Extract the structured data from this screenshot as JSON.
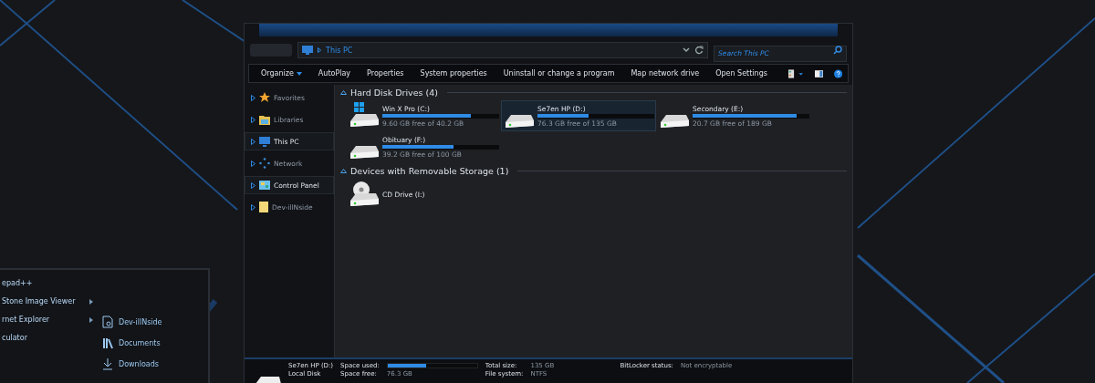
{
  "start_menu": {
    "programs": [
      {
        "label": "epad++",
        "submenu": false
      },
      {
        "label": "Stone Image Viewer",
        "submenu": true
      },
      {
        "label": "rnet Explorer",
        "submenu": true
      },
      {
        "label": "culator",
        "submenu": false
      }
    ],
    "places": [
      {
        "label": "Dev-illNside"
      },
      {
        "label": "Documents"
      },
      {
        "label": "Downloads"
      }
    ]
  },
  "explorer": {
    "address": "This PC",
    "search": {
      "placeholder": "Search This PC"
    },
    "toolbar": [
      {
        "label": "Organize",
        "dropdown": true
      },
      {
        "label": "AutoPlay",
        "dropdown": false
      },
      {
        "label": "Properties",
        "dropdown": false
      },
      {
        "label": "System properties",
        "dropdown": false
      },
      {
        "label": "Uninstall or change a program",
        "dropdown": false
      },
      {
        "label": "Map network drive",
        "dropdown": false
      },
      {
        "label": "Open Settings",
        "dropdown": false
      }
    ],
    "sidebar": [
      {
        "label": "Favorites",
        "selected": false
      },
      {
        "label": "Libraries",
        "selected": false
      },
      {
        "label": "This PC",
        "selected": true
      },
      {
        "label": "Network",
        "selected": false
      },
      {
        "label": "Control Panel",
        "selected": true
      },
      {
        "label": "Dev-illNside",
        "selected": false
      }
    ],
    "groups": [
      {
        "title": "Hard Disk Drives (4)",
        "items": [
          {
            "name": "Win X Pro (C:)",
            "free": "9.60 GB free of 40.2 GB",
            "level": 0.76,
            "selected": false,
            "kind": "system"
          },
          {
            "name": "Se7en HP (D:)",
            "free": "76.3 GB free of 135 GB",
            "level": 0.435,
            "selected": true,
            "kind": "disk"
          },
          {
            "name": "Secondary (E:)",
            "free": "20.7 GB free of 189 GB",
            "level": 0.89,
            "selected": false,
            "kind": "disk"
          },
          {
            "name": "Obituary (F:)",
            "free": "39.2 GB free of 100 GB",
            "level": 0.61,
            "selected": false,
            "kind": "disk"
          }
        ]
      },
      {
        "title": "Devices with Removable Storage (1)",
        "items": [
          {
            "name": "CD Drive (I:)",
            "selected": false,
            "kind": "cd"
          }
        ]
      }
    ],
    "details": {
      "name": "Se7en HP (D:)",
      "type": "Local Disk",
      "space_used": {
        "label": "Space used:",
        "level": 0.435
      },
      "space_free_label": "Space free:",
      "space_free": "76.3 GB",
      "total_label": "Total size:",
      "total": "135 GB",
      "fs_label": "File system:",
      "fs": "NTFS",
      "bitlocker_label": "BitLocker status:",
      "bitlocker": "Not encryptable"
    }
  }
}
